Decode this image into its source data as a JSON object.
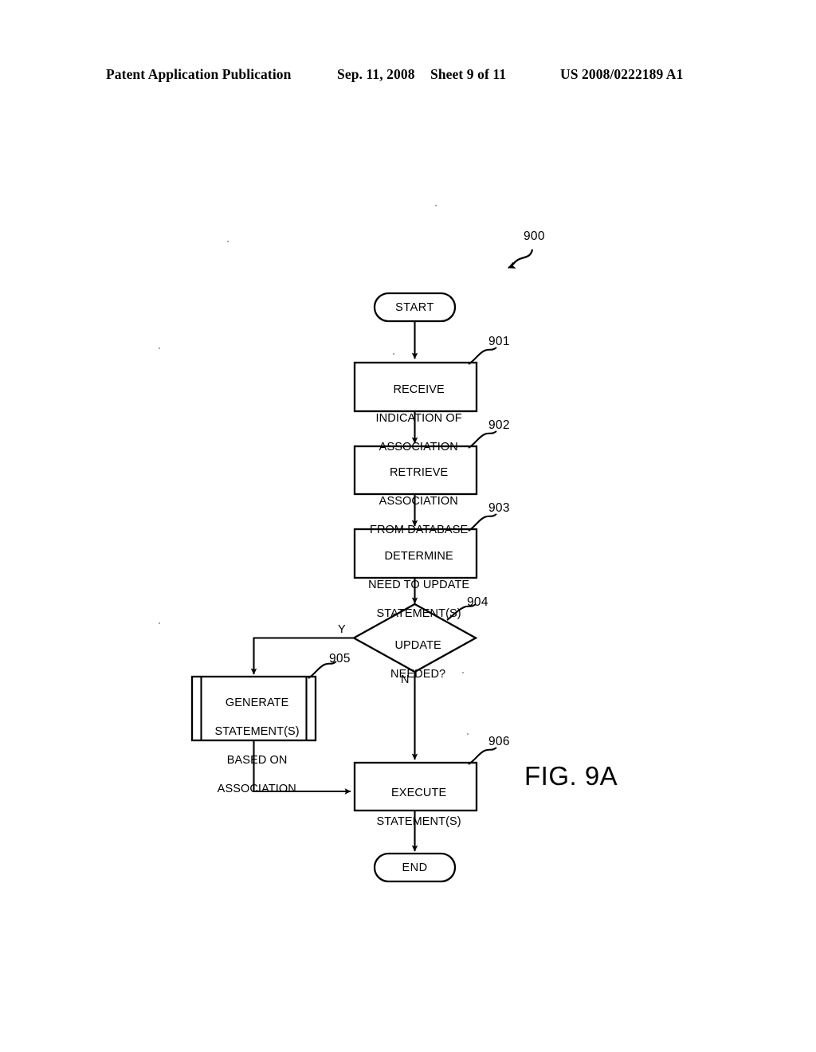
{
  "header": {
    "publication": "Patent Application Publication",
    "date": "Sep. 11, 2008",
    "sheet": "Sheet 9 of 11",
    "patent_number": "US 2008/0222189 A1"
  },
  "figure": {
    "label": "FIG. 9A",
    "diagram_reference": "900",
    "nodes": [
      {
        "id": "start",
        "ref": "",
        "shape": "terminator",
        "text": "START",
        "lines": [
          "START"
        ]
      },
      {
        "id": "n901",
        "ref": "901",
        "shape": "process",
        "text": "RECEIVE INDICATION OF ASSOCIATION",
        "lines": [
          "RECEIVE",
          "INDICATION OF",
          "ASSOCIATION"
        ]
      },
      {
        "id": "n902",
        "ref": "902",
        "shape": "process",
        "text": "RETRIEVE ASSOCIATION FROM DATABASE",
        "lines": [
          "RETRIEVE",
          "ASSOCIATION",
          "FROM DATABASE"
        ]
      },
      {
        "id": "n903",
        "ref": "903",
        "shape": "process",
        "text": "DETERMINE NEED TO UPDATE STATEMENT(S)",
        "lines": [
          "DETERMINE",
          "NEED TO UPDATE",
          "STATEMENT(S)"
        ]
      },
      {
        "id": "n904",
        "ref": "904",
        "shape": "decision",
        "text": "UPDATE NEEDED?",
        "lines": [
          "UPDATE",
          "NEEDED?"
        ]
      },
      {
        "id": "n905",
        "ref": "905",
        "shape": "predefined-process",
        "text": "GENERATE STATEMENT(S) BASED ON ASSOCIATION",
        "lines": [
          "GENERATE",
          "STATEMENT(S)",
          "BASED ON",
          "ASSOCIATION"
        ]
      },
      {
        "id": "n906",
        "ref": "906",
        "shape": "process",
        "text": "EXECUTE STATEMENT(S)",
        "lines": [
          "EXECUTE",
          "STATEMENT(S)"
        ]
      },
      {
        "id": "end",
        "ref": "",
        "shape": "terminator",
        "text": "END",
        "lines": [
          "END"
        ]
      }
    ],
    "branch_labels": {
      "yes": "Y",
      "no": "N"
    },
    "edges": [
      {
        "from": "start",
        "to": "n901",
        "label": ""
      },
      {
        "from": "n901",
        "to": "n902",
        "label": ""
      },
      {
        "from": "n902",
        "to": "n903",
        "label": ""
      },
      {
        "from": "n903",
        "to": "n904",
        "label": ""
      },
      {
        "from": "n904",
        "to": "n905",
        "label": "Y"
      },
      {
        "from": "n904",
        "to": "n906",
        "label": "N"
      },
      {
        "from": "n905",
        "to": "n906",
        "label": ""
      },
      {
        "from": "n906",
        "to": "end",
        "label": ""
      }
    ]
  },
  "colors": {
    "ink": "#000000",
    "paper": "#ffffff"
  }
}
